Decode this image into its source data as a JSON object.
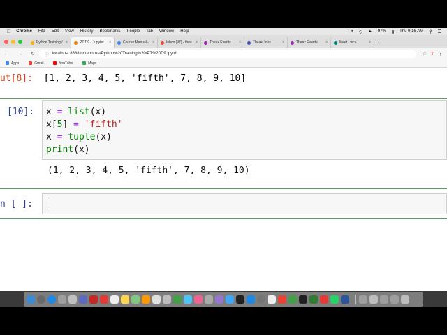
{
  "mac_menubar": {
    "app": "Chrome",
    "items": [
      "File",
      "Edit",
      "View",
      "History",
      "Bookmarks",
      "People",
      "Tab",
      "Window",
      "Help"
    ],
    "battery": "97%",
    "clock": "Thu 9:16 AM"
  },
  "tabs": [
    {
      "label": "Python Training /",
      "color": "#f4b400"
    },
    {
      "label": "PT D9 - Jupyter",
      "color": "#f57c00",
      "active": true
    },
    {
      "label": "Course Manual -",
      "color": "#4285f4"
    },
    {
      "label": "Inbox (97) - thea",
      "color": "#ea4335"
    },
    {
      "label": "Theax Events",
      "color": "#9c27b0"
    },
    {
      "label": "Theax Jobs",
      "color": "#3f51b5"
    },
    {
      "label": "Theax Events",
      "color": "#9c27b0"
    },
    {
      "label": "Meet - wcu",
      "color": "#00897b"
    }
  ],
  "url": "localhost:8888/notebooks/Python%20Training%20/PT%20D9.ipynb",
  "bookmarks": [
    {
      "label": "Apps",
      "color": "#4285f4"
    },
    {
      "label": "Gmail",
      "color": "#ea4335"
    },
    {
      "label": "YouTube",
      "color": "#ff0000"
    },
    {
      "label": "Maps",
      "color": "#34a853"
    }
  ],
  "notebook": {
    "out8_prompt": "ut[8]:",
    "out8_value": "[1, 2, 3, 4, 5, 'fifth', 7, 8, 9, 10]",
    "cell10_prompt": "[10]:",
    "code": {
      "l1_var": "x",
      "l1_op": "=",
      "l1_func": "list",
      "l1_arg": "(x)",
      "l2_var": "x[",
      "l2_idx": "5",
      "l2_close": "]",
      "l2_op": "=",
      "l2_str": "'fifth'",
      "l3_var": "x",
      "l3_op": "=",
      "l3_func": "tuple",
      "l3_arg": "(x)",
      "l4_func": "print",
      "l4_arg": "(x)"
    },
    "cell10_output": "(1, 2, 3, 4, 5, 'fifth', 7, 8, 9, 10)",
    "empty_prompt": "n [ ]:"
  },
  "dock_colors": [
    "#3d8bd4",
    "#6a6a6a",
    "#1e88e5",
    "#9e9e9e",
    "#c0c0c0",
    "#5c6bc0",
    "#c62828",
    "#e53935",
    "#eeeeee",
    "#ffd54f",
    "#81c784",
    "#ff9800",
    "#e0e0e0",
    "#bdbdbd",
    "#43a047",
    "#4fc3f7",
    "#f06292",
    "#aaaaaa",
    "#9575cd",
    "#42a5f5",
    "#212121",
    "#1e88e5",
    "#757575",
    "#eeeeee",
    "#ea4335",
    "#43a047",
    "#212121",
    "#2e7d32",
    "#e53935",
    "#25d366",
    "#2b579a",
    "#9e9e9e",
    "#bdbdbd",
    "#9e9e9e",
    "#9e9e9e",
    "#bdbdbd"
  ]
}
